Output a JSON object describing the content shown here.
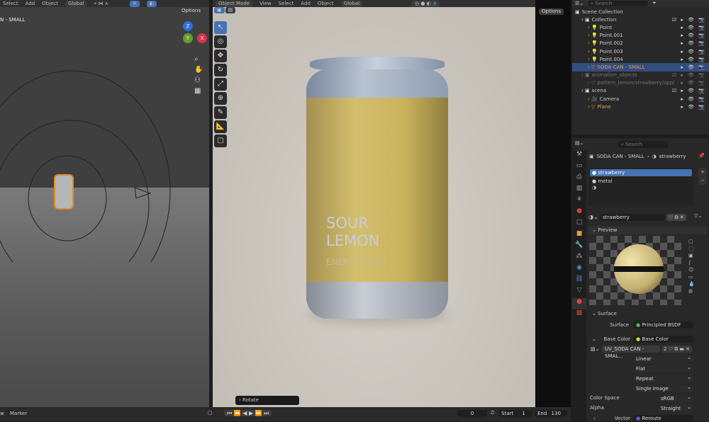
{
  "left_header": {
    "menus": [
      "Select",
      "Add",
      "Object"
    ],
    "orientation": "Global",
    "options": "Options"
  },
  "left_viewport": {
    "object_label": "N - SMALL",
    "gizmo": {
      "z": "Z",
      "x": "X",
      "y": "Y"
    }
  },
  "center_header": {
    "mode": "Object Mode",
    "menus": [
      "View",
      "Select",
      "Add",
      "Object"
    ],
    "orientation": "Global",
    "options": "Options"
  },
  "can": {
    "line1": "SOUR",
    "line2": "LEMON",
    "line3": "ENERGY SHOT"
  },
  "operator_panel": "Rotate",
  "outliner": {
    "search_placeholder": "Search",
    "items": [
      {
        "label": "Scene Collection",
        "depth": 0,
        "type": "collection"
      },
      {
        "label": "Collection",
        "depth": 1,
        "type": "collection"
      },
      {
        "label": "Point",
        "depth": 2,
        "type": "light"
      },
      {
        "label": "Point.001",
        "depth": 2,
        "type": "light"
      },
      {
        "label": "Point.002",
        "depth": 2,
        "type": "light"
      },
      {
        "label": "Point.003",
        "depth": 2,
        "type": "light"
      },
      {
        "label": "Point.004",
        "depth": 2,
        "type": "light"
      },
      {
        "label": "SODA CAN - SMALL",
        "depth": 2,
        "type": "mesh",
        "selected": true
      },
      {
        "label": "animation_objects",
        "depth": 1,
        "type": "collection",
        "dim": true
      },
      {
        "label": "pattern_lemon/strawberry/appl",
        "depth": 2,
        "type": "mesh",
        "dim": true
      },
      {
        "label": "scena",
        "depth": 1,
        "type": "collection"
      },
      {
        "label": "Camera",
        "depth": 2,
        "type": "camera"
      },
      {
        "label": "Plane",
        "depth": 2,
        "type": "mesh"
      }
    ]
  },
  "properties": {
    "search_placeholder": "Search",
    "breadcrumb": {
      "object": "SODA CAN - SMALL",
      "material": "strawberry"
    },
    "slots": [
      "strawberry",
      "metal"
    ],
    "material_name": "strawberry",
    "preview_label": "Preview",
    "surface_section": "Surface",
    "surface_label": "Surface",
    "surface_value": "Principled BSDF",
    "base_color_label": "Base Color",
    "base_color_value": "Base Color",
    "image_name": "UV_SODA CAN - SMAL...",
    "image_users": "2",
    "interpolation": "Linear",
    "projection": "Flat",
    "extension": "Repeat",
    "source": "Single Image",
    "color_space_label": "Color Space",
    "color_space": "sRGB",
    "alpha_label": "Alpha",
    "alpha": "Straight",
    "vector_label": "Vector",
    "vector_value": "Reroute"
  },
  "timeline": {
    "menus": [
      "w",
      "Marker"
    ],
    "current_frame": "0",
    "start_label": "Start",
    "start": "1",
    "end_label": "End",
    "end": "130"
  },
  "colors": {
    "accent": "#4772b3",
    "selected_row": "#334d80"
  }
}
